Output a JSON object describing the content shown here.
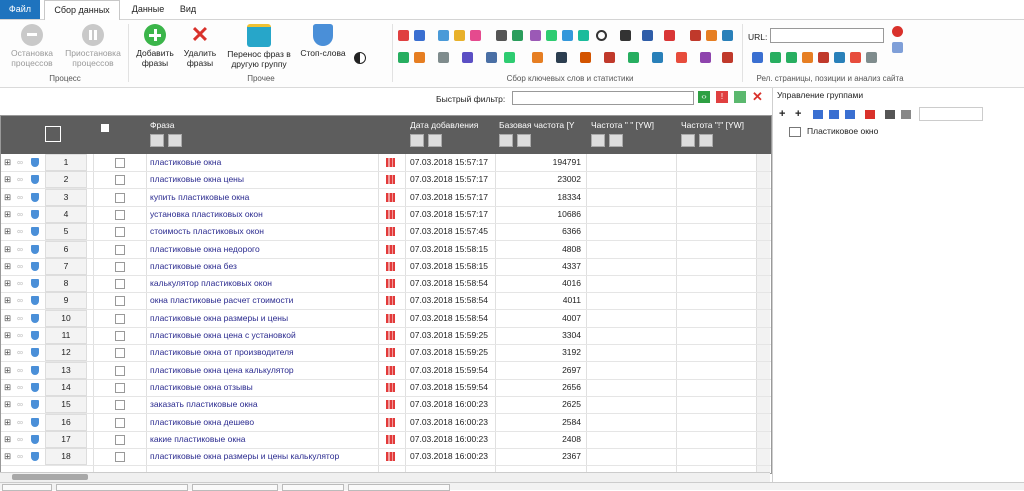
{
  "menu": {
    "tabs": [
      "Файл",
      "Сбор данных",
      "Данные",
      "Вид"
    ]
  },
  "ribbon": {
    "process": {
      "stop_label": "Остановка процессов",
      "pause_label": "Приостановка процессов",
      "group_label": "Процесс"
    },
    "other": {
      "add_label": "Добавить фразы",
      "delete_label": "Удалить фразы",
      "transfer_label": "Перенос фраз в другую группу",
      "stopwords_label": "Стоп-слова",
      "group_label": "Прочее"
    },
    "collect_group_label": "Сбор ключевых слов и статистики",
    "url_label": "URL:",
    "url_value": "",
    "site_group_label": "Рел. страницы, позиции и анализ сайта"
  },
  "filter": {
    "label": "Быстрый фильтр:",
    "value": ""
  },
  "table": {
    "headers": {
      "phrase": "Фраза",
      "date": "Дата добавления",
      "base_freq": "Базовая частота [Y",
      "freq_quotes": "Частота \" \" [YW]",
      "freq_excl": "Частота \"!\" [YW]"
    },
    "rows": [
      {
        "n": "1",
        "phrase": "пластиковые окна",
        "date": "07.03.2018 15:57:17",
        "freq": "194791"
      },
      {
        "n": "2",
        "phrase": "пластиковые окна цены",
        "date": "07.03.2018 15:57:17",
        "freq": "23002"
      },
      {
        "n": "3",
        "phrase": "купить пластиковые окна",
        "date": "07.03.2018 15:57:17",
        "freq": "18334"
      },
      {
        "n": "4",
        "phrase": "установка пластиковых окон",
        "date": "07.03.2018 15:57:17",
        "freq": "10686"
      },
      {
        "n": "5",
        "phrase": "стоимость пластиковых окон",
        "date": "07.03.2018 15:57:45",
        "freq": "6366"
      },
      {
        "n": "6",
        "phrase": "пластиковые окна недорого",
        "date": "07.03.2018 15:58:15",
        "freq": "4808"
      },
      {
        "n": "7",
        "phrase": "пластиковые окна без",
        "date": "07.03.2018 15:58:15",
        "freq": "4337"
      },
      {
        "n": "8",
        "phrase": "калькулятор пластиковых окон",
        "date": "07.03.2018 15:58:54",
        "freq": "4016"
      },
      {
        "n": "9",
        "phrase": "окна пластиковые расчет стоимости",
        "date": "07.03.2018 15:58:54",
        "freq": "4011"
      },
      {
        "n": "10",
        "phrase": "пластиковые окна размеры и цены",
        "date": "07.03.2018 15:58:54",
        "freq": "4007"
      },
      {
        "n": "11",
        "phrase": "пластиковые окна цена с установкой",
        "date": "07.03.2018 15:59:25",
        "freq": "3304"
      },
      {
        "n": "12",
        "phrase": "пластиковые окна от производителя",
        "date": "07.03.2018 15:59:25",
        "freq": "3192"
      },
      {
        "n": "13",
        "phrase": "пластиковые окна цена калькулятор",
        "date": "07.03.2018 15:59:54",
        "freq": "2697"
      },
      {
        "n": "14",
        "phrase": "пластиковые окна отзывы",
        "date": "07.03.2018 15:59:54",
        "freq": "2656"
      },
      {
        "n": "15",
        "phrase": "заказать пластиковые окна",
        "date": "07.03.2018 16:00:23",
        "freq": "2625"
      },
      {
        "n": "16",
        "phrase": "пластиковые окна дешево",
        "date": "07.03.2018 16:00:23",
        "freq": "2584"
      },
      {
        "n": "17",
        "phrase": "какие пластиковые окна",
        "date": "07.03.2018 16:00:23",
        "freq": "2408"
      },
      {
        "n": "18",
        "phrase": "пластиковые окна размеры и цены калькулятор",
        "date": "07.03.2018 16:00:23",
        "freq": "2367"
      }
    ]
  },
  "groups": {
    "title": "Управление группами",
    "items": [
      "Пластиковое окно"
    ]
  },
  "colors": {
    "file_tab": "#1e73be",
    "header_bg": "#5d5d5d",
    "phrase_text": "#2a2a8f",
    "add_green": "#3bb54a",
    "delete_red": "#d9312b",
    "transfer_teal": "#27a6c9",
    "stopwords_blue": "#4a8fd8"
  }
}
